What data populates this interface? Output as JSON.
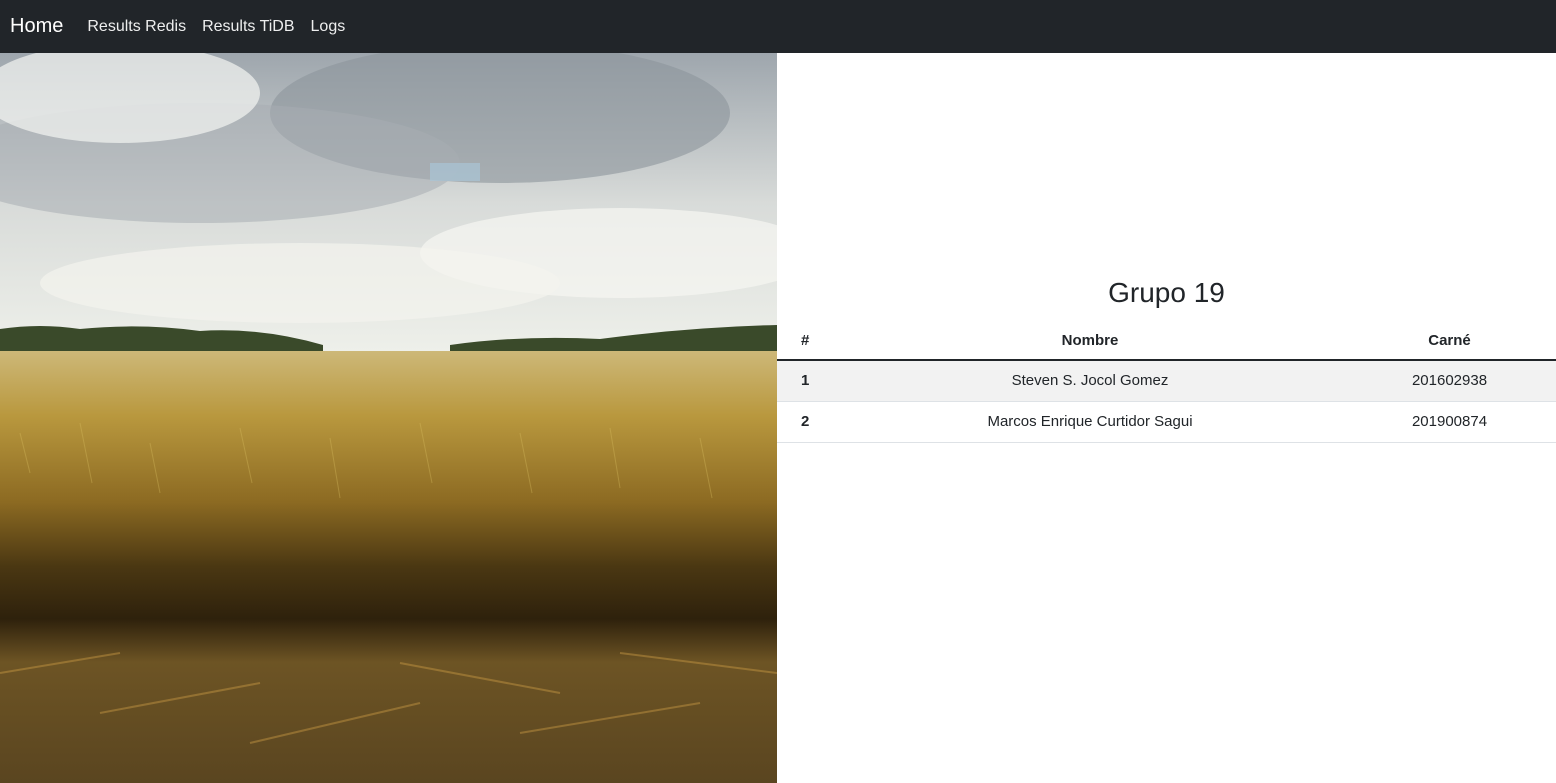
{
  "navbar": {
    "brand": "Home",
    "links": [
      "Results Redis",
      "Results TiDB",
      "Logs"
    ]
  },
  "hero_image": "photo of a wheat field under a cloudy sky",
  "group": {
    "title": "Grupo 19",
    "headers": [
      "#",
      "Nombre",
      "Carné"
    ],
    "rows": [
      {
        "num": "1",
        "name": "Steven S. Jocol Gomez",
        "carne": "201602938"
      },
      {
        "num": "2",
        "name": "Marcos Enrique Curtidor Sagui",
        "carne": "201900874"
      }
    ]
  }
}
